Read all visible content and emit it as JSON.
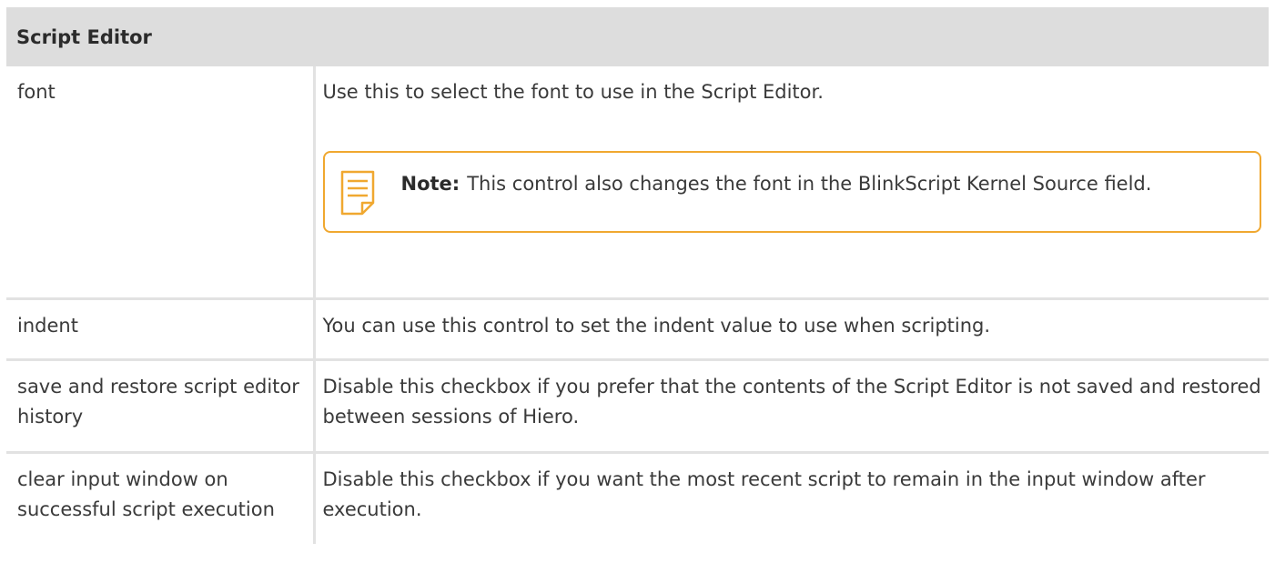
{
  "section_title": "Script Editor",
  "rows": [
    {
      "name": "font",
      "description": "Use this to select the font to use in the Script Editor.",
      "note": {
        "label": "Note:",
        "text": "This control also changes the font in the BlinkScript Kernel Source field."
      }
    },
    {
      "name": "indent",
      "description": "You can use this control to set the indent value to use when scripting."
    },
    {
      "name": "save and restore script editor history",
      "description": "Disable this checkbox if you prefer that the contents of the Script Editor is not saved and restored between sessions of Hiero."
    },
    {
      "name": "clear input window on successful script execution",
      "description": "Disable this checkbox if you want the most recent script to remain in the input window after execution."
    }
  ],
  "colors": {
    "header_bg": "#dddddd",
    "border": "#e2e2e2",
    "note_border": "#f0a830",
    "text": "#3a3a3a"
  },
  "icons": {
    "note": "note-icon"
  }
}
